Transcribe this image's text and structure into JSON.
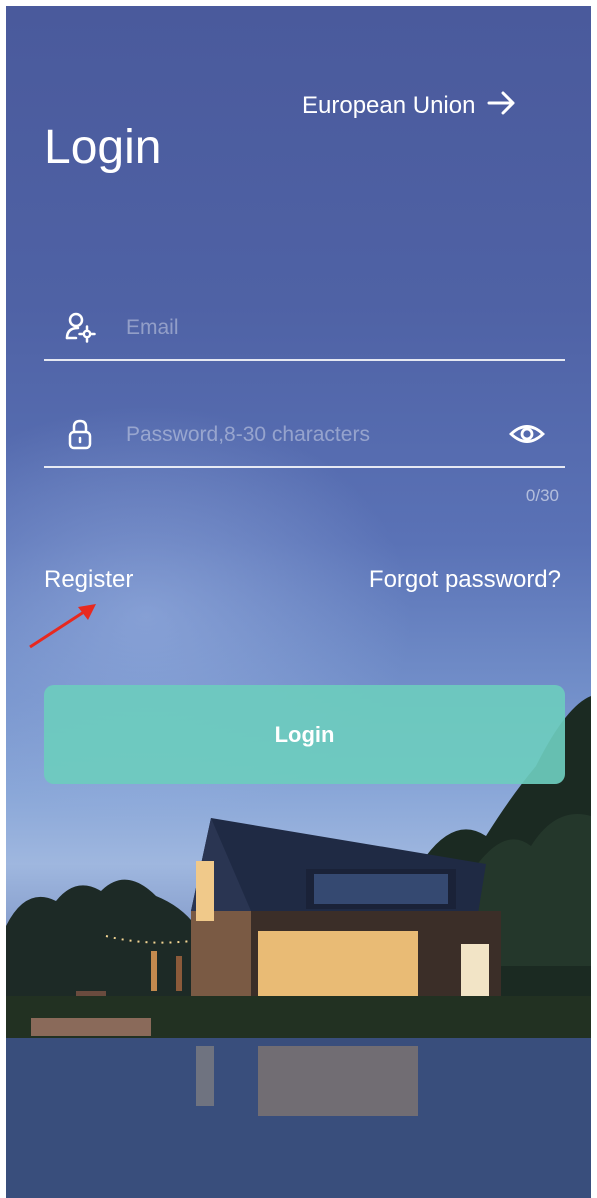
{
  "header": {
    "region_label": "European Union",
    "region_arrow": "→",
    "title": "Login"
  },
  "form": {
    "email": {
      "placeholder": "Email",
      "value": ""
    },
    "password": {
      "placeholder": "Password,8-30 characters",
      "value": ""
    },
    "password_counter": "0/30"
  },
  "links": {
    "register": "Register",
    "forgot_password": "Forgot password?"
  },
  "login_button": "Login",
  "icons": {
    "email": "user-settings-icon",
    "password": "lock-icon",
    "visibility": "eye-icon",
    "region": "arrow-right-icon",
    "annotation": "red-arrow-annotation"
  },
  "colors": {
    "login_button": "#6cccbe",
    "annotation_arrow": "#e8291f"
  }
}
